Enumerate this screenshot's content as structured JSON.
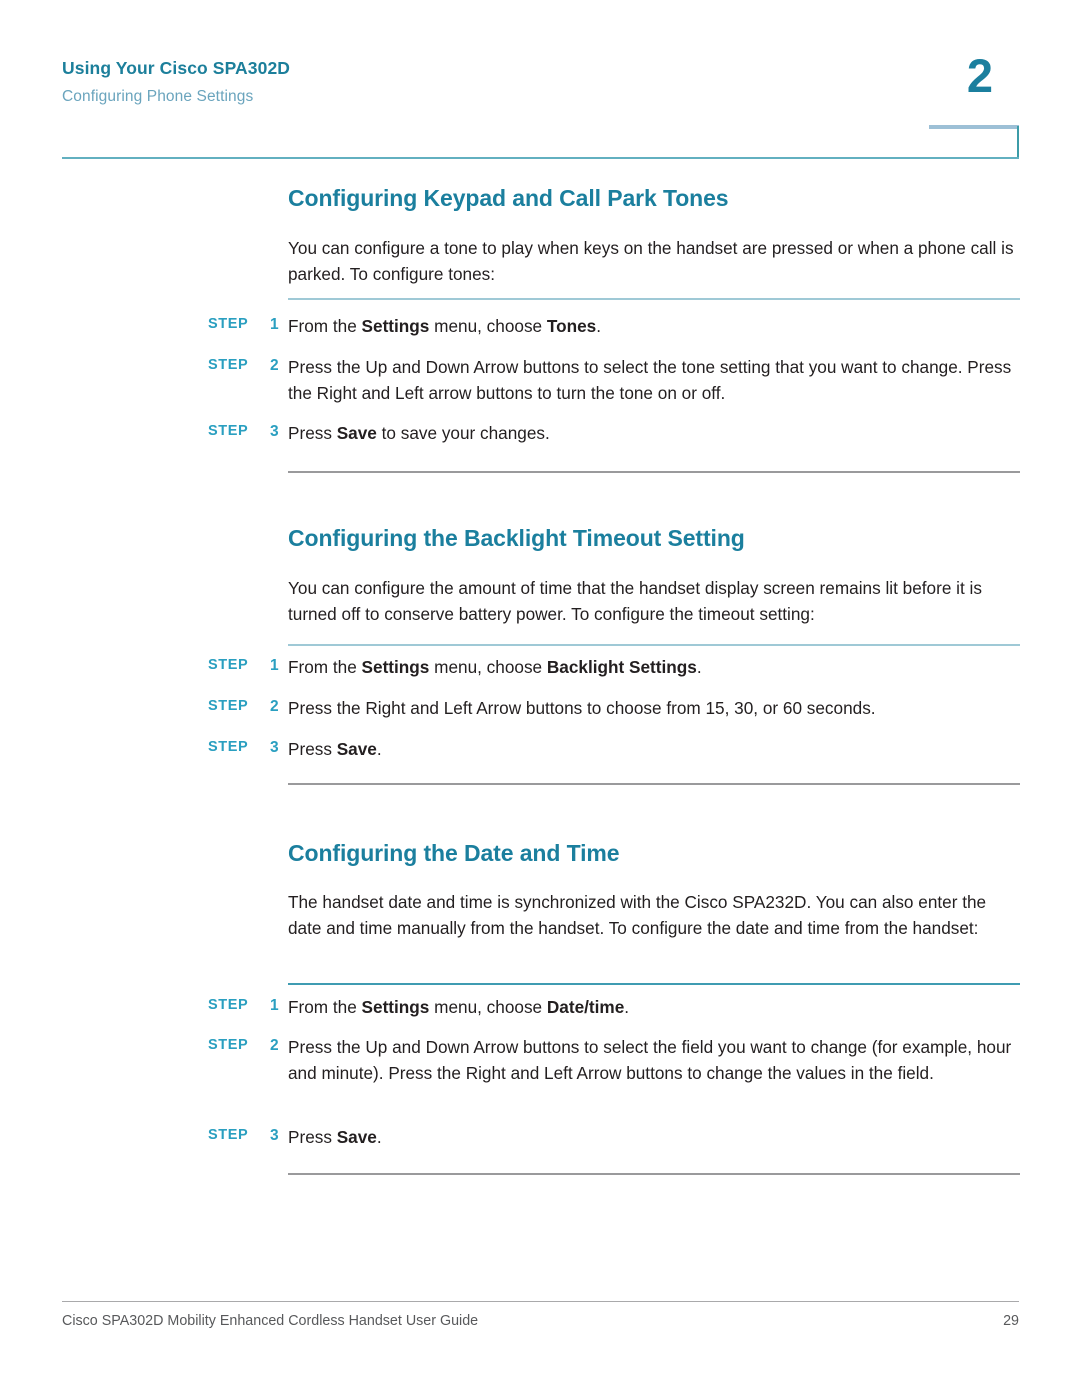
{
  "header": {
    "title": "Using Your Cisco SPA302D",
    "subtitle": "Configuring Phone Settings",
    "chapter_number": "2",
    "accent_color": "#1b7f9e",
    "rule_color": "#62b0c0"
  },
  "sections": [
    {
      "heading": "Configuring Keypad and Call Park Tones",
      "intro": "You can configure a tone to play when keys on the handset are pressed or when a phone call is parked. To configure tones:",
      "steps": [
        {
          "label": "STEP",
          "number": "1",
          "text_html": "From the <b>Settings</b> menu, choose <b>Tones</b>.",
          "text_plain": "From the Settings menu, choose Tones."
        },
        {
          "label": "STEP",
          "number": "2",
          "text_html": "Press the Up and Down Arrow buttons to select the tone setting that you want to change. Press the Right and Left arrow buttons to turn the tone on or off.",
          "text_plain": "Press the Up and Down Arrow buttons to select the tone setting that you want to change. Press the Right and Left arrow buttons to turn the tone on or off."
        },
        {
          "label": "STEP",
          "number": "3",
          "text_html": "Press <b>Save</b> to save your changes.",
          "text_plain": "Press Save to save your changes."
        }
      ]
    },
    {
      "heading": "Configuring the Backlight Timeout Setting",
      "intro": "You can configure the amount of time that the handset display screen remains lit before it is turned off to conserve battery power. To configure the timeout setting:",
      "steps": [
        {
          "label": "STEP",
          "number": "1",
          "text_html": "From the <b>Settings</b> menu, choose <b>Backlight Settings</b>.",
          "text_plain": "From the Settings menu, choose Backlight Settings."
        },
        {
          "label": "STEP",
          "number": "2",
          "text_html": "Press the Right and Left Arrow buttons to choose from  15, 30, or 60 seconds.",
          "text_plain": "Press the Right and Left Arrow buttons to choose from 15, 30, or 60 seconds."
        },
        {
          "label": "STEP",
          "number": "3",
          "text_html": "Press <b>Save</b>.",
          "text_plain": "Press Save."
        }
      ]
    },
    {
      "heading": "Configuring the Date and Time",
      "intro": "The handset date and time is synchronized with the Cisco SPA232D. You can also enter the date and time manually from the handset. To configure the date and time from the handset:",
      "steps": [
        {
          "label": "STEP",
          "number": "1",
          "text_html": "From the <b>Settings</b> menu, choose <b>Date/time</b>.",
          "text_plain": "From the Settings menu, choose Date/time."
        },
        {
          "label": "STEP",
          "number": "2",
          "text_html": "Press the Up and Down Arrow buttons to select the field you want to change (for example, hour and minute). Press the Right and Left Arrow buttons to change the values in the field.",
          "text_plain": "Press the Up and Down Arrow buttons to select the field you want to change (for example, hour and minute). Press the Right and Left Arrow buttons to change the values in the field."
        },
        {
          "label": "STEP",
          "number": "3",
          "text_html": "Press <b>Save</b>.",
          "text_plain": "Press Save."
        }
      ]
    }
  ],
  "footer": {
    "document_title": "Cisco SPA302D Mobility Enhanced Cordless Handset User Guide",
    "page_number": "29"
  }
}
